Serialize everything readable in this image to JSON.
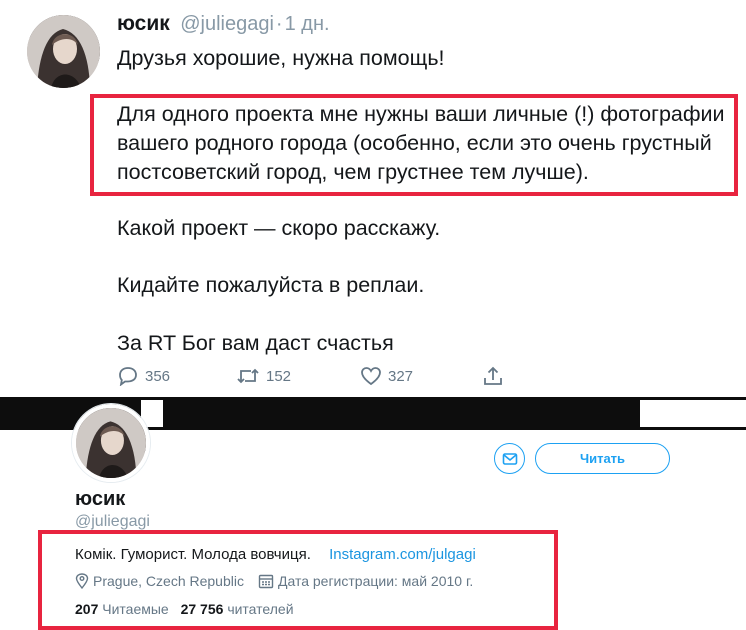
{
  "tweet": {
    "author_name": "юсик",
    "author_handle": "@juliegagi",
    "separator": "·",
    "time": "1 дн.",
    "line_intro": "Друзья хорошие, нужна помощь!",
    "highlight_lines": [
      "Для одного проекта мне нужны ваши личные (!) фотографии",
      "вашего родного города (особенно, если это очень грустный",
      "постсоветский город, чем грустнее тем лучше)."
    ],
    "line_project": "Какой проект — скоро расскажу.",
    "line_replies": "Кидайте пожалуйста в реплаи.",
    "line_rt": "За RT Бог вам даст счастья",
    "actions": {
      "reply_count": "356",
      "retweet_count": "152",
      "like_count": "327"
    }
  },
  "profile": {
    "name": "юсик",
    "handle": "@juliegagi",
    "message_icon": "envelope-icon",
    "follow_label": "Читать",
    "bio_text": "Комік. Гуморист. Молода вовчиця.",
    "bio_link": "Instagram.com/julgagi",
    "location": "Prague, Czech Republic",
    "joined": "Дата регистрации: май 2010 г.",
    "following_count": "207",
    "following_label": "Читаемые",
    "followers_count": "27 756",
    "followers_label": "читателей"
  },
  "colors": {
    "highlight_border": "#e8243f",
    "accent": "#1da1f2",
    "secondary_text": "#657786"
  }
}
